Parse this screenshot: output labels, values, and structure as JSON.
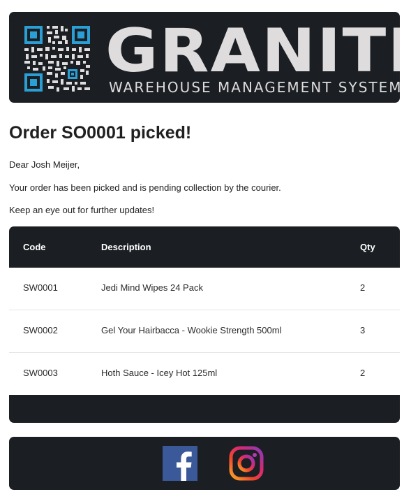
{
  "header": {
    "logo_word": "GRANITE",
    "logo_sub": "WAREHOUSE MANAGEMENT SYSTEM",
    "logo_icon": "qr-code-icon"
  },
  "email": {
    "title": "Order SO0001 picked!",
    "greeting": "Dear Josh Meijer,",
    "body1": "Your order has been picked and is pending collection by the courier.",
    "body2": "Keep an eye out for further updates!"
  },
  "table": {
    "headers": {
      "code": "Code",
      "description": "Description",
      "qty": "Qty"
    },
    "rows": [
      {
        "code": "SW0001",
        "description": "Jedi Mind Wipes 24 Pack",
        "qty": "2"
      },
      {
        "code": "SW0002",
        "description": "Gel Your Hairbacca - Wookie Strength 500ml",
        "qty": "3"
      },
      {
        "code": "SW0003",
        "description": "Hoth Sauce - Icey Hot 125ml",
        "qty": "2"
      }
    ]
  },
  "footer": {
    "social": [
      {
        "icon": "facebook-icon"
      },
      {
        "icon": "instagram-icon"
      }
    ]
  },
  "colors": {
    "dark_panel": "#1b1f24",
    "qr_accent": "#2a9fd6",
    "logo_text": "#dedcdc",
    "facebook": "#3b5998"
  }
}
